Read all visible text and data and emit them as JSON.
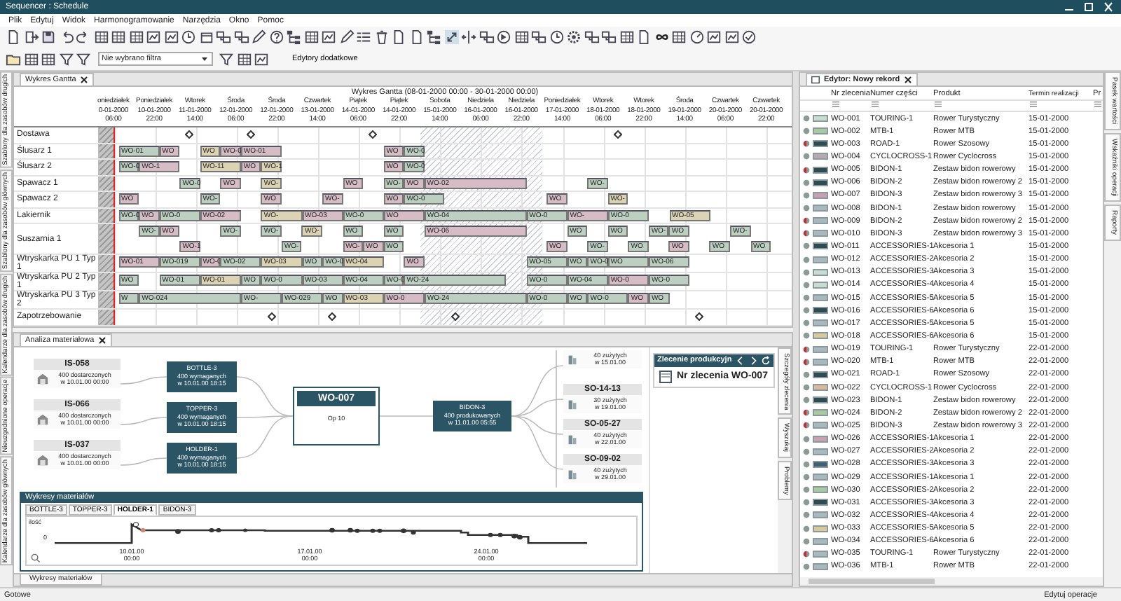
{
  "window": {
    "title": "Sequencer : Schedule"
  },
  "menu": [
    "Plik",
    "Edytuj",
    "Widok",
    "Harmonogramowanie",
    "Narzędzia",
    "Okno",
    "Pomoc"
  ],
  "toolbar": {
    "filter": {
      "value": "Nie wybrano filtra"
    },
    "editors_button": "Edytory dodatkowe"
  },
  "left_tabs": [
    "Szablony dla zasobów drugich",
    "Szablony dla zasobów głównych",
    "Kalendarze dla zasobów drugich",
    "Nieuzgodnione operacje",
    "Kalendarze dla zasobów głównych"
  ],
  "gantt": {
    "tab": "Wykres Gantta",
    "title": "Wykres Gantta   (08-01-2000 00:00 - 30-01-2000 00:00)",
    "ticks": [
      {
        "day": "oniedziałek",
        "date": "0-01-2000",
        "time": "06:00"
      },
      {
        "day": "Poniedziałek",
        "date": "10-01-2000",
        "time": "22:00"
      },
      {
        "day": "Wtorek",
        "date": "11-01-2000",
        "time": "14:00"
      },
      {
        "day": "Środa",
        "date": "12-01-2000",
        "time": "06:00"
      },
      {
        "day": "Środa",
        "date": "12-01-2000",
        "time": "22:00"
      },
      {
        "day": "Czwartek",
        "date": "13-01-2000",
        "time": "14:00"
      },
      {
        "day": "Piątek",
        "date": "14-01-2000",
        "time": "06:00"
      },
      {
        "day": "Piątek",
        "date": "14-01-2000",
        "time": "22:00"
      },
      {
        "day": "Sobota",
        "date": "15-01-2000",
        "time": "14:00"
      },
      {
        "day": "Niedziela",
        "date": "16-01-2000",
        "time": "06:00"
      },
      {
        "day": "Niedziela",
        "date": "16-01-2000",
        "time": "22:00"
      },
      {
        "day": "Poniedziałek",
        "date": "17-01-2000",
        "time": "14:00"
      },
      {
        "day": "Wtorek",
        "date": "18-01-2000",
        "time": "06:00"
      },
      {
        "day": "Wtorek",
        "date": "18-01-2000",
        "time": "22:00"
      },
      {
        "day": "Środa",
        "date": "19-01-2000",
        "time": "14:00"
      },
      {
        "day": "Czwartek",
        "date": "20-01-2000",
        "time": "06:00"
      },
      {
        "day": "Czwartek",
        "date": "20-01-2000",
        "time": "22:00"
      }
    ],
    "rows": [
      {
        "name": "Dostawa",
        "lanes": [
          [
            {
              "kind": "gap"
            },
            {
              "kind": "gap"
            },
            {
              "kind": "gap"
            },
            {
              "kind": "gap"
            },
            {
              "kind": "milestone"
            },
            {
              "kind": "gap"
            },
            {
              "kind": "gap"
            },
            {
              "kind": "milestone"
            },
            {
              "kind": "gap"
            },
            {
              "kind": "gap"
            },
            {
              "kind": "gap"
            },
            {
              "kind": "gap"
            },
            {
              "kind": "gap"
            },
            {
              "kind": "milestone"
            },
            {
              "kind": "gap"
            },
            {
              "kind": "gap"
            },
            {
              "kind": "gap"
            },
            {
              "kind": "gap"
            },
            {
              "kind": "gap"
            },
            {
              "kind": "gap"
            },
            {
              "kind": "gap"
            },
            {
              "kind": "gap"
            },
            {
              "kind": "gap"
            },
            {
              "kind": "gap"
            },
            {
              "kind": "gap"
            },
            {
              "kind": "milestone"
            }
          ]
        ]
      },
      {
        "name": "Ślusarz 1",
        "lanes": [
          [
            {
              "kind": "gap"
            },
            {
              "kind": "wide",
              "label": "WO-01",
              "color": "#bccfc0"
            },
            {
              "kind": "bar",
              "label": "WO",
              "color": "#d6bcc4"
            },
            {
              "kind": "gap"
            },
            {
              "kind": "bar",
              "label": "WO",
              "color": "#dcd2b4"
            },
            {
              "kind": "bar",
              "label": "WO-0",
              "color": "#d6bcc4"
            },
            {
              "kind": "wide",
              "label": "WO-01",
              "color": "#d6bcc4"
            },
            {
              "kind": "gap"
            },
            {
              "kind": "gap"
            },
            {
              "kind": "gap"
            },
            {
              "kind": "gap"
            },
            {
              "kind": "gap"
            },
            {
              "kind": "bar",
              "label": "WO",
              "color": "#d6bcc4"
            },
            {
              "kind": "bar",
              "label": "WO-0",
              "color": "#bccfc0"
            }
          ]
        ]
      },
      {
        "name": "Ślusarz 2",
        "lanes": [
          [
            {
              "kind": "gap"
            },
            {
              "kind": "bar",
              "label": "WO-0",
              "color": "#bccfc0"
            },
            {
              "kind": "wide",
              "label": "WO-1",
              "color": "#d6bcc4"
            },
            {
              "kind": "gap"
            },
            {
              "kind": "wide",
              "label": "WO-11",
              "color": "#dcd2b4"
            },
            {
              "kind": "bar",
              "label": "WO",
              "color": "#d6bcc4"
            },
            {
              "kind": "bar",
              "label": "WO-1",
              "color": "#dcd2b4"
            },
            {
              "kind": "gap"
            },
            {
              "kind": "gap"
            },
            {
              "kind": "gap"
            },
            {
              "kind": "gap"
            },
            {
              "kind": "gap"
            },
            {
              "kind": "bar",
              "label": "WO",
              "color": "#d6bcc4"
            },
            {
              "kind": "bar",
              "label": "WO-0",
              "color": "#bccfc0"
            }
          ]
        ]
      },
      {
        "name": "Spawacz 1",
        "lanes": [
          [
            {
              "kind": "gap"
            },
            {
              "kind": "gap"
            },
            {
              "kind": "gap"
            },
            {
              "kind": "gap"
            },
            {
              "kind": "bar",
              "label": "WO-0",
              "color": "#bccfc0"
            },
            {
              "kind": "gap"
            },
            {
              "kind": "bar",
              "label": "WO",
              "color": "#d6bcc4"
            },
            {
              "kind": "gap"
            },
            {
              "kind": "bar",
              "label": "WO-",
              "color": "#dcd2b4"
            },
            {
              "kind": "gap"
            },
            {
              "kind": "gap"
            },
            {
              "kind": "gap"
            },
            {
              "kind": "bar",
              "label": "WO",
              "color": "#d6bcc4"
            },
            {
              "kind": "gap"
            },
            {
              "kind": "bar",
              "label": "WO-",
              "color": "#bccfc0"
            },
            {
              "kind": "bar",
              "label": "WO",
              "color": "#d6bcc4"
            },
            {
              "kind": "long",
              "label": "WO-02",
              "color": "#d6bcc4"
            },
            {
              "kind": "gap"
            },
            {
              "kind": "gap"
            },
            {
              "kind": "gap"
            },
            {
              "kind": "bar",
              "label": "WO-",
              "color": "#bccfc0"
            }
          ]
        ]
      },
      {
        "name": "Spawacz 2",
        "lanes": [
          [
            {
              "kind": "gap"
            },
            {
              "kind": "bar",
              "label": "WO",
              "color": "#d6bcc4"
            },
            {
              "kind": "gap"
            },
            {
              "kind": "gap"
            },
            {
              "kind": "gap"
            },
            {
              "kind": "bar",
              "label": "WO-",
              "color": "#bccfc0"
            },
            {
              "kind": "gap"
            },
            {
              "kind": "gap"
            },
            {
              "kind": "bar",
              "label": "WO",
              "color": "#d6bcc4"
            },
            {
              "kind": "gap"
            },
            {
              "kind": "gap"
            },
            {
              "kind": "bar",
              "label": "WO-",
              "color": "#d6bcc4"
            },
            {
              "kind": "gap"
            },
            {
              "kind": "gap"
            },
            {
              "kind": "bar",
              "label": "WO",
              "color": "#d6bcc4"
            },
            {
              "kind": "wide",
              "label": "WO-0",
              "color": "#bccfc0"
            },
            {
              "kind": "gap"
            },
            {
              "kind": "gap"
            },
            {
              "kind": "gap"
            },
            {
              "kind": "gap"
            },
            {
              "kind": "gap"
            },
            {
              "kind": "bar",
              "label": "WO",
              "color": "#d6bcc4"
            },
            {
              "kind": "gap"
            },
            {
              "kind": "gap"
            },
            {
              "kind": "bar",
              "label": "WO-",
              "color": "#dcd2b4"
            }
          ]
        ]
      },
      {
        "name": "Lakiernik",
        "lanes": [
          [
            {
              "kind": "gap"
            },
            {
              "kind": "bar",
              "label": "WO-0",
              "color": "#bccfc0"
            },
            {
              "kind": "bar",
              "label": "WO",
              "color": "#d6bcc4"
            },
            {
              "kind": "wide",
              "label": "WO-0",
              "color": "#bccfc0"
            },
            {
              "kind": "wide",
              "label": "WO-02",
              "color": "#d6bcc4"
            },
            {
              "kind": "gap"
            },
            {
              "kind": "wide",
              "label": "WO-",
              "color": "#dcd2b4"
            },
            {
              "kind": "wide",
              "label": "WO-03",
              "color": "#d6bcc4"
            },
            {
              "kind": "wide",
              "label": "WO-0",
              "color": "#bccfc0"
            },
            {
              "kind": "wide",
              "label": "WO",
              "color": "#d6bcc4"
            },
            {
              "kind": "long",
              "label": "WO-04",
              "color": "#bccfc0"
            },
            {
              "kind": "wide",
              "label": "WO-0",
              "color": "#bccfc0"
            },
            {
              "kind": "wide",
              "label": "WO-",
              "color": "#d6bcc4"
            },
            {
              "kind": "wide",
              "label": "WO-0",
              "color": "#bccfc0"
            },
            {
              "kind": "gap"
            },
            {
              "kind": "wide",
              "label": "WO-05",
              "color": "#dcd2b4"
            }
          ]
        ]
      },
      {
        "name": "Suszarnia 1",
        "lanes": [
          [
            {
              "kind": "gap"
            },
            {
              "kind": "gap"
            },
            {
              "kind": "bar",
              "label": "WO-",
              "color": "#bccfc0"
            },
            {
              "kind": "bar",
              "label": "WO",
              "color": "#d6bcc4"
            },
            {
              "kind": "gap"
            },
            {
              "kind": "gap"
            },
            {
              "kind": "bar",
              "label": "WO-",
              "color": "#bccfc0"
            },
            {
              "kind": "gap"
            },
            {
              "kind": "bar",
              "label": "WO-",
              "color": "#bccfc0"
            },
            {
              "kind": "gap"
            },
            {
              "kind": "bar",
              "label": "WO-",
              "color": "#dcd2b4"
            },
            {
              "kind": "gap"
            },
            {
              "kind": "bar",
              "label": "WO",
              "color": "#bccfc0"
            },
            {
              "kind": "gap"
            },
            {
              "kind": "bar",
              "label": "WO",
              "color": "#bccfc0"
            },
            {
              "kind": "gap"
            },
            {
              "kind": "long",
              "label": "WO-06",
              "color": "#d6bcc4"
            },
            {
              "kind": "gap"
            },
            {
              "kind": "gap"
            },
            {
              "kind": "bar",
              "label": "WO",
              "color": "#bccfc0"
            },
            {
              "kind": "gap"
            },
            {
              "kind": "bar",
              "label": "WO",
              "color": "#bccfc0"
            },
            {
              "kind": "gap"
            },
            {
              "kind": "bar",
              "label": "WO-",
              "color": "#bccfc0"
            },
            {
              "kind": "bar",
              "label": "WO",
              "color": "#bccfc0"
            },
            {
              "kind": "gap"
            },
            {
              "kind": "gap"
            },
            {
              "kind": "bar",
              "label": "WO-",
              "color": "#bccfc0"
            }
          ],
          [
            {
              "kind": "gap"
            },
            {
              "kind": "gap"
            },
            {
              "kind": "gap"
            },
            {
              "kind": "gap"
            },
            {
              "kind": "bar",
              "label": "WO-1",
              "color": "#d6bcc4"
            },
            {
              "kind": "gap"
            },
            {
              "kind": "gap"
            },
            {
              "kind": "gap"
            },
            {
              "kind": "gap"
            },
            {
              "kind": "bar",
              "label": "WO-",
              "color": "#bccfc0"
            },
            {
              "kind": "gap"
            },
            {
              "kind": "gap"
            },
            {
              "kind": "bar",
              "label": "WO-",
              "color": "#d6bcc4"
            },
            {
              "kind": "bar",
              "label": "WO",
              "color": "#d6bcc4"
            },
            {
              "kind": "bar",
              "label": "WO",
              "color": "#bccfc0"
            },
            {
              "kind": "gap"
            },
            {
              "kind": "gap"
            },
            {
              "kind": "gap"
            },
            {
              "kind": "gap"
            },
            {
              "kind": "gap"
            },
            {
              "kind": "gap"
            },
            {
              "kind": "gap"
            },
            {
              "kind": "bar",
              "label": "WO",
              "color": "#d6bcc4"
            },
            {
              "kind": "gap"
            },
            {
              "kind": "bar",
              "label": "WO-",
              "color": "#bccfc0"
            },
            {
              "kind": "gap"
            },
            {
              "kind": "bar",
              "label": "WO",
              "color": "#bccfc0"
            },
            {
              "kind": "gap"
            },
            {
              "kind": "bar",
              "label": "WO",
              "color": "#d6bcc4"
            },
            {
              "kind": "gap"
            },
            {
              "kind": "bar",
              "label": "WO",
              "color": "#bccfc0"
            },
            {
              "kind": "gap"
            },
            {
              "kind": "bar",
              "label": "WO",
              "color": "#bccfc0"
            }
          ]
        ]
      },
      {
        "name": "Wtryskarka PU 1 Typ 1",
        "lanes": [
          [
            {
              "kind": "gap"
            },
            {
              "kind": "wide",
              "label": "WO-01",
              "color": "#d6bcc4"
            },
            {
              "kind": "wide",
              "label": "WO-019",
              "color": "#bccfc0"
            },
            {
              "kind": "bar",
              "label": "WO-0",
              "color": "#d6bcc4"
            },
            {
              "kind": "wide",
              "label": "WO-02",
              "color": "#bccfc0"
            },
            {
              "kind": "wide",
              "label": "WO-03",
              "color": "#dcd2b4"
            },
            {
              "kind": "bar",
              "label": "WO",
              "color": "#bccfc0"
            },
            {
              "kind": "bar",
              "label": "WO-0",
              "color": "#bccfc0"
            },
            {
              "kind": "wide",
              "label": "WO-04",
              "color": "#dcd2b4"
            },
            {
              "kind": "gap"
            },
            {
              "kind": "bar",
              "label": "WO",
              "color": "#d6bcc4"
            },
            {
              "kind": "gap"
            },
            {
              "kind": "gap"
            },
            {
              "kind": "gap"
            },
            {
              "kind": "gap"
            },
            {
              "kind": "gap"
            },
            {
              "kind": "wide",
              "label": "WO-05",
              "color": "#bccfc0"
            },
            {
              "kind": "bar",
              "label": "WO",
              "color": "#bccfc0"
            },
            {
              "kind": "bar",
              "label": "WO-0",
              "color": "#bccfc0"
            },
            {
              "kind": "wide",
              "label": "WO",
              "color": "#bccfc0"
            },
            {
              "kind": "wide",
              "label": "WO-06",
              "color": "#bccfc0"
            }
          ]
        ]
      },
      {
        "name": "Wtryskarka PU 2 Typ 1",
        "lanes": [
          [
            {
              "kind": "gap"
            },
            {
              "kind": "bar",
              "label": "WO",
              "color": "#bccfc0"
            },
            {
              "kind": "gap"
            },
            {
              "kind": "wide",
              "label": "WO-01",
              "color": "#bccfc0"
            },
            {
              "kind": "wide",
              "label": "WO-01",
              "color": "#dcd2b4"
            },
            {
              "kind": "bar",
              "label": "WO",
              "color": "#bccfc0"
            },
            {
              "kind": "wide",
              "label": "WO-0",
              "color": "#bccfc0"
            },
            {
              "kind": "wide",
              "label": "WO-03",
              "color": "#bccfc0"
            },
            {
              "kind": "wide",
              "label": "WO-04",
              "color": "#bccfc0"
            },
            {
              "kind": "bar",
              "label": "WO-0",
              "color": "#bccfc0"
            },
            {
              "kind": "long",
              "label": "WO-24",
              "color": "#bccfc0"
            },
            {
              "kind": "gap"
            },
            {
              "kind": "wide",
              "label": "WO-0",
              "color": "#bccfc0"
            },
            {
              "kind": "wide",
              "label": "WO-04",
              "color": "#bccfc0"
            },
            {
              "kind": "wide",
              "label": "WO-0",
              "color": "#d6bcc4"
            },
            {
              "kind": "wide",
              "label": "WO-0",
              "color": "#bccfc0"
            }
          ]
        ]
      },
      {
        "name": "Wtryskarka PU 3 Typ 2",
        "lanes": [
          [
            {
              "kind": "gap"
            },
            {
              "kind": "bar",
              "label": "W",
              "color": "#bccfc0"
            },
            {
              "kind": "long",
              "label": "WO-024",
              "color": "#bccfc0"
            },
            {
              "kind": "wide",
              "label": "WO-",
              "color": "#bccfc0"
            },
            {
              "kind": "wide",
              "label": "WO-029",
              "color": "#bccfc0"
            },
            {
              "kind": "bar",
              "label": "WO",
              "color": "#bccfc0"
            },
            {
              "kind": "wide",
              "label": "WO-03",
              "color": "#dcd2b4"
            },
            {
              "kind": "wide",
              "label": "WO-0",
              "color": "#d6bcc4"
            },
            {
              "kind": "long",
              "label": "WO-24",
              "color": "#bccfc0"
            },
            {
              "kind": "wide",
              "label": "WO-0",
              "color": "#bccfc0"
            },
            {
              "kind": "bar",
              "label": "WO",
              "color": "#bccfc0"
            },
            {
              "kind": "wide",
              "label": "WO-0",
              "color": "#bccfc0"
            },
            {
              "kind": "bar",
              "label": "WO",
              "color": "#d6bcc4"
            },
            {
              "kind": "bar",
              "label": "WO",
              "color": "#bccfc0"
            }
          ]
        ]
      },
      {
        "name": "Zapotrzebowanie",
        "lanes": [
          [
            {
              "kind": "gap"
            },
            {
              "kind": "gap"
            },
            {
              "kind": "gap"
            },
            {
              "kind": "gap"
            },
            {
              "kind": "gap"
            },
            {
              "kind": "gap"
            },
            {
              "kind": "gap"
            },
            {
              "kind": "gap"
            },
            {
              "kind": "milestone"
            },
            {
              "kind": "gap"
            },
            {
              "kind": "gap"
            },
            {
              "kind": "milestone"
            },
            {
              "kind": "gap"
            },
            {
              "kind": "gap"
            },
            {
              "kind": "gap"
            },
            {
              "kind": "gap"
            },
            {
              "kind": "gap"
            },
            {
              "kind": "milestone"
            },
            {
              "kind": "gap"
            },
            {
              "kind": "gap"
            },
            {
              "kind": "gap"
            },
            {
              "kind": "gap"
            },
            {
              "kind": "gap"
            },
            {
              "kind": "gap"
            },
            {
              "kind": "gap"
            },
            {
              "kind": "gap"
            },
            {
              "kind": "gap"
            },
            {
              "kind": "gap"
            },
            {
              "kind": "gap"
            },
            {
              "kind": "milestone"
            }
          ]
        ]
      }
    ]
  },
  "analysis": {
    "tab": "Analiza materiałowa",
    "sources": [
      {
        "id": "IS-058",
        "qty": "400 dostarczonych",
        "when": "w 10.01.00 00:00"
      },
      {
        "id": "IS-066",
        "qty": "400 dostarczonych",
        "when": "w 10.01.00 00:00"
      },
      {
        "id": "IS-037",
        "qty": "400 dostarczonych",
        "when": "w 10.01.00 00:00"
      }
    ],
    "materials": [
      {
        "id": "BOTTLE-3",
        "qty": "400 wymaganych",
        "when": "w 10.01.00 18:15"
      },
      {
        "id": "TOPPER-3",
        "qty": "400 wymaganych",
        "when": "w 10.01.00 18:15"
      },
      {
        "id": "HOLDER-1",
        "qty": "400 wymaganych",
        "when": "w 10.01.00 18:15"
      }
    ],
    "order": {
      "id": "WO-007",
      "operation": "Op 10"
    },
    "product": {
      "id": "BIDON-3",
      "qty": "400 produkowanych",
      "when": "w 11.01.00 05:55"
    },
    "sales": [
      {
        "qty": "40 zużytych",
        "when": "w 15.01.00"
      },
      {
        "id": "SO-14-13",
        "qty": "30 zużytych",
        "when": "w 19.01.00"
      },
      {
        "id": "SO-05-27",
        "qty": "40 zużytych",
        "when": "w 22.01.00"
      },
      {
        "id": "SO-09-02",
        "qty": "40 zużytych",
        "when": "w 29.01.00"
      }
    ],
    "order_panel": {
      "title": "Zlecenie produkcyjn",
      "number": "Nr zlecenia WO-007"
    },
    "side_tabs": [
      "Szczegóły zlecenia",
      "Wyszukaj",
      "Problemy"
    ],
    "material_charts": {
      "title": "Wykresy materiałów",
      "tabs": [
        {
          "label": "BOTTLE-3",
          "selected": false
        },
        {
          "label": "TOPPER-3",
          "selected": false
        },
        {
          "label": "HOLDER-1",
          "selected": true
        },
        {
          "label": "BIDON-3",
          "selected": false
        }
      ],
      "y_label": "ilość",
      "zero": "0",
      "x_labels": [
        {
          "date": "10.01.00",
          "time": "00:00"
        },
        {
          "date": "17.01.00",
          "time": "00:00"
        },
        {
          "date": "24.01.00",
          "time": "00:00"
        }
      ]
    },
    "bottom_tab": "Wykresy materiałów"
  },
  "editor": {
    "tab": "Edytor: Nowy rekord",
    "columns": [
      "Nr zlecenia",
      "Numer części",
      "Produkt",
      "Termin realizacji",
      "Pr"
    ],
    "rows": [
      {
        "warning": false,
        "color": "#c9dccf",
        "order": "WO-001",
        "part": "TOURING-1",
        "product": "Rower Turystyczny",
        "due": "15-01-2000"
      },
      {
        "warning": false,
        "color": "#a9c9a0",
        "order": "WO-002",
        "part": "MTB-1",
        "product": "Rower MTB",
        "due": "15-01-2000"
      },
      {
        "warning": true,
        "color": "#2f4b52",
        "order": "WO-003",
        "part": "ROAD-1",
        "product": "Rower Szosowy",
        "due": "15-01-2000"
      },
      {
        "warning": false,
        "color": "#b8a8b0",
        "order": "WO-004",
        "part": "CYCLOCROSS-1",
        "product": "Rower Cyclocross",
        "due": "15-01-2000"
      },
      {
        "warning": true,
        "color": "#2f4b52",
        "order": "WO-005",
        "part": "BIDON-1",
        "product": "Zestaw bidon rowerowy",
        "due": "15-01-2000"
      },
      {
        "warning": false,
        "color": "#2f4b52",
        "order": "WO-006",
        "part": "BIDON-2",
        "product": "Zestaw bidon rowerowy 2",
        "due": "15-01-2000"
      },
      {
        "warning": false,
        "color": "#c9a0b0",
        "order": "WO-007",
        "part": "BIDON-3",
        "product": "Zestaw bidon rowerowy 3",
        "due": "15-01-2000"
      },
      {
        "warning": false,
        "color": "#a8b8bc",
        "order": "WO-008",
        "part": "BIDON-1",
        "product": "Zestaw bidon rowerowy",
        "due": "15-01-2000"
      },
      {
        "warning": true,
        "color": "#a8b8bc",
        "order": "WO-009",
        "part": "BIDON-2",
        "product": "Zestaw bidon rowerowy 2",
        "due": "15-01-2000"
      },
      {
        "warning": true,
        "color": "#a8b8bc",
        "order": "WO-010",
        "part": "BIDON-3",
        "product": "Zestaw bidon rowerowy 3",
        "due": "15-01-2000"
      },
      {
        "warning": false,
        "color": "#2f4b52",
        "order": "WO-011",
        "part": "ACCESSORIES-1",
        "product": "Akcesoria 1",
        "due": "15-01-2000"
      },
      {
        "warning": false,
        "color": "#a8b8bc",
        "order": "WO-012",
        "part": "ACCESSORIES-2",
        "product": "Akcesoria 2",
        "due": "15-01-2000"
      },
      {
        "warning": false,
        "color": "#c9dccf",
        "order": "WO-013",
        "part": "ACCESSORIES-3",
        "product": "Akcesoria 3",
        "due": "15-01-2000"
      },
      {
        "warning": false,
        "color": "#c9dccf",
        "order": "WO-014",
        "part": "ACCESSORIES-4",
        "product": "Akcesoria 4",
        "due": "15-01-2000"
      },
      {
        "warning": false,
        "color": "#a8b8bc",
        "order": "WO-015",
        "part": "ACCESSORIES-5",
        "product": "Akcesoria 5",
        "due": "15-01-2000"
      },
      {
        "warning": false,
        "color": "#2f4b52",
        "order": "WO-016",
        "part": "ACCESSORIES-6",
        "product": "Akcesoria 6",
        "due": "15-01-2000"
      },
      {
        "warning": false,
        "color": "#a8b8bc",
        "order": "WO-017",
        "part": "ACCESSORIES-5",
        "product": "Akcesoria 5",
        "due": "15-01-2000"
      },
      {
        "warning": false,
        "color": "#d7c99a",
        "order": "WO-018",
        "part": "ACCESSORIES-6",
        "product": "Akcesoria 6",
        "due": "15-01-2000"
      },
      {
        "warning": true,
        "color": "#a8b8bc",
        "order": "WO-019",
        "part": "TOURING-1",
        "product": "Rower Turystyczny",
        "due": "22-01-2000"
      },
      {
        "warning": true,
        "color": "#a8b8bc",
        "order": "WO-020",
        "part": "MTB-1",
        "product": "Rower MTB",
        "due": "22-01-2000"
      },
      {
        "warning": false,
        "color": "#2f4b52",
        "order": "WO-021",
        "part": "ROAD-1",
        "product": "Rower Szosowy",
        "due": "22-01-2000"
      },
      {
        "warning": false,
        "color": "#d7b89a",
        "order": "WO-022",
        "part": "CYCLOCROSS-1",
        "product": "Rower Cyclocross",
        "due": "22-01-2000"
      },
      {
        "warning": false,
        "color": "#2f4b52",
        "order": "WO-023",
        "part": "BIDON-1",
        "product": "Zestaw bidon rowerowy",
        "due": "22-01-2000"
      },
      {
        "warning": true,
        "color": "#a9c9a0",
        "order": "WO-024",
        "part": "BIDON-2",
        "product": "Zestaw bidon rowerowy 2",
        "due": "22-01-2000"
      },
      {
        "warning": true,
        "color": "#a8b8bc",
        "order": "WO-025",
        "part": "BIDON-3",
        "product": "Zestaw bidon rowerowy 3",
        "due": "22-01-2000"
      },
      {
        "warning": false,
        "color": "#c9a0b0",
        "order": "WO-026",
        "part": "ACCESSORIES-1",
        "product": "Akcesoria 1",
        "due": "22-01-2000"
      },
      {
        "warning": false,
        "color": "#a8b8bc",
        "order": "WO-027",
        "part": "ACCESSORIES-2",
        "product": "Akcesoria 2",
        "due": "22-01-2000"
      },
      {
        "warning": false,
        "color": "#3e6070",
        "order": "WO-028",
        "part": "ACCESSORIES-3",
        "product": "Akcesoria 3",
        "due": "22-01-2000"
      },
      {
        "warning": false,
        "color": "#a8b8bc",
        "order": "WO-029",
        "part": "ACCESSORIES-1",
        "product": "Akcesoria 1",
        "due": "22-01-2000"
      },
      {
        "warning": false,
        "color": "#a9c9a0",
        "order": "WO-030",
        "part": "ACCESSORIES-2",
        "product": "Akcesoria 2",
        "due": "22-01-2000"
      },
      {
        "warning": false,
        "color": "#2f4b52",
        "order": "WO-031",
        "part": "ACCESSORIES-3",
        "product": "Akcesoria 3",
        "due": "22-01-2000"
      },
      {
        "warning": false,
        "color": "#a8b8bc",
        "order": "WO-032",
        "part": "ACCESSORIES-4",
        "product": "Akcesoria 4",
        "due": "22-01-2000"
      },
      {
        "warning": false,
        "color": "#d7c99a",
        "order": "WO-033",
        "part": "ACCESSORIES-5",
        "product": "Akcesoria 5",
        "due": "22-01-2000"
      },
      {
        "warning": false,
        "color": "#a8b8bc",
        "order": "WO-034",
        "part": "ACCESSORIES-6",
        "product": "Akcesoria 6",
        "due": "22-01-2000"
      },
      {
        "warning": true,
        "color": "#a8b8bc",
        "order": "WO-035",
        "part": "TOURING-1",
        "product": "Rower Turystyczny",
        "due": "22-01-2000"
      },
      {
        "warning": false,
        "color": "#a8b8bc",
        "order": "WO-036",
        "part": "MTB-1",
        "product": "Rower MTB",
        "due": "22-01-2000"
      }
    ]
  },
  "right_tabs": [
    "Pasek wartości",
    "Wskaźniki operacji",
    "Raporty"
  ],
  "status_bar": {
    "left": "Gotowe",
    "right": "Edytuj operacje"
  }
}
